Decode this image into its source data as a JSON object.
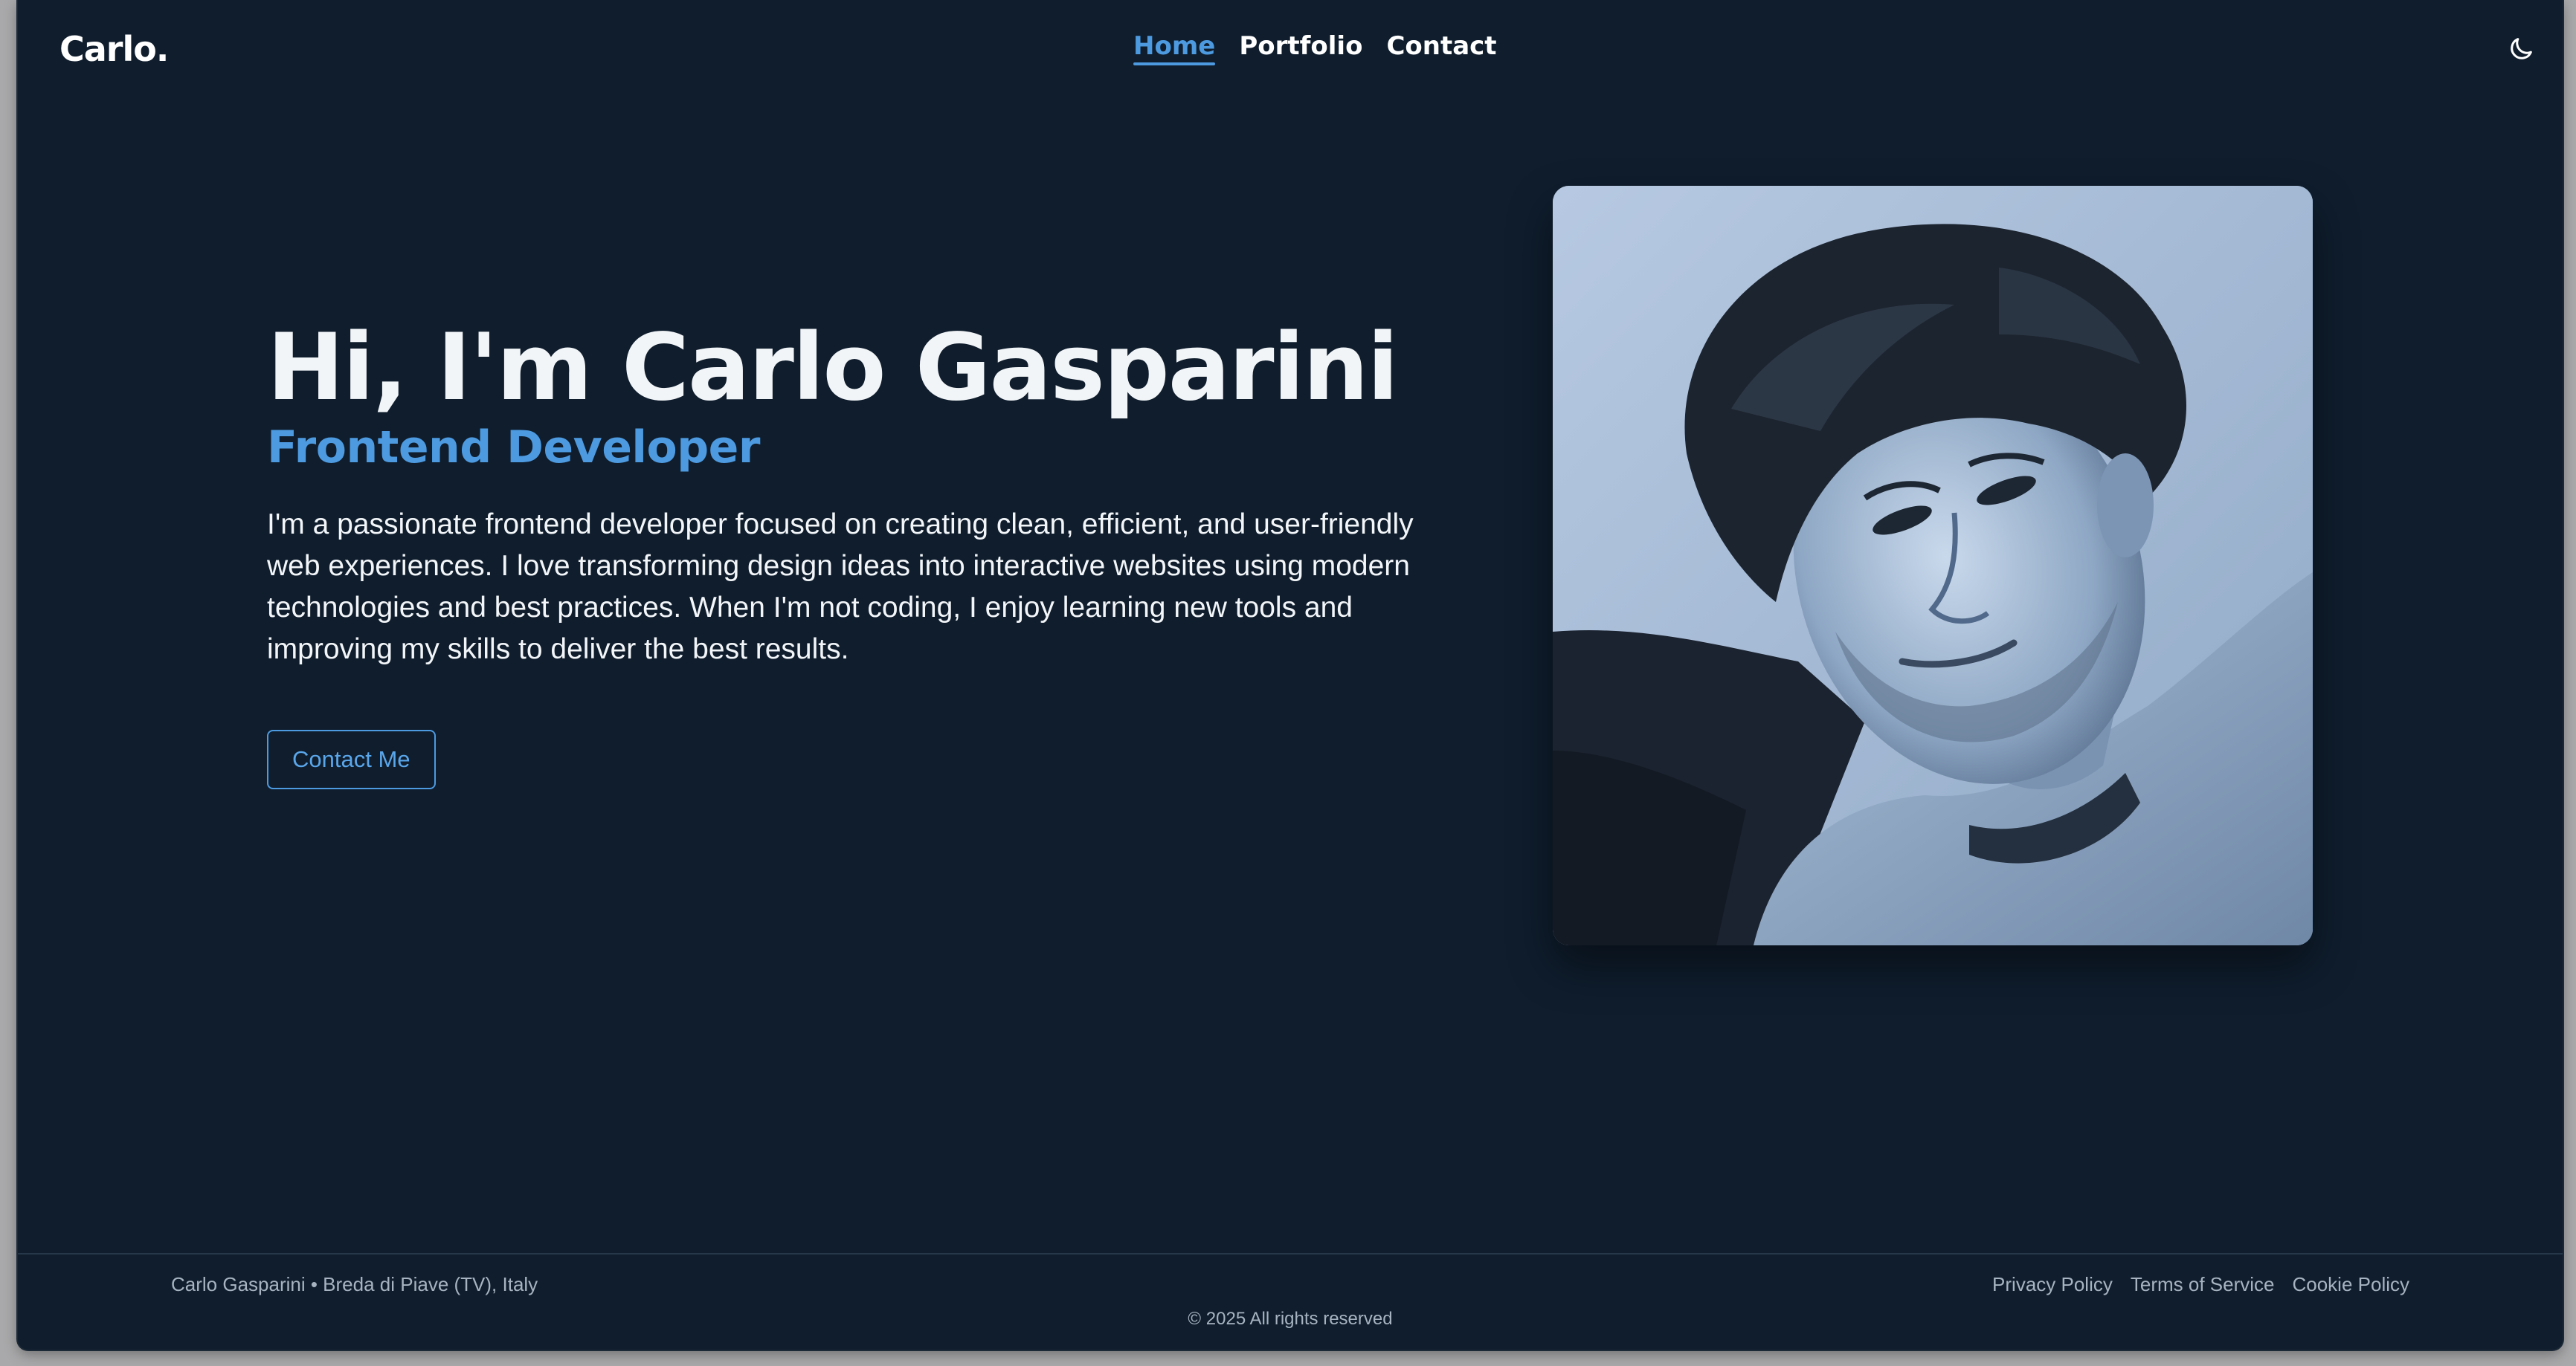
{
  "header": {
    "logo": "Carlo.",
    "nav": [
      {
        "label": "Home",
        "active": true
      },
      {
        "label": "Portfolio",
        "active": false
      },
      {
        "label": "Contact",
        "active": false
      }
    ],
    "theme_toggle_icon": "moon-icon"
  },
  "hero": {
    "title": "Hi, I'm Carlo Gasparini",
    "role": "Frontend Developer",
    "description": "I'm a passionate frontend developer focused on creating clean, efficient, and user-friendly web experiences. I love transforming design ideas into interactive websites using modern technologies and best practices. When I'm not coding, I enjoy learning new tools and improving my skills to deliver the best results.",
    "cta_label": "Contact Me",
    "portrait_icon": "portrait-photo"
  },
  "footer": {
    "location": "Carlo Gasparini • Breda di Piave (TV), Italy",
    "links": [
      "Privacy Policy",
      "Terms of Service",
      "Cookie Policy"
    ],
    "copyright": "© 2025 All rights reserved"
  },
  "colors": {
    "background": "#0f1d2d",
    "accent": "#4d9ae0",
    "text": "#ffffff",
    "muted": "#a7b3c0"
  }
}
